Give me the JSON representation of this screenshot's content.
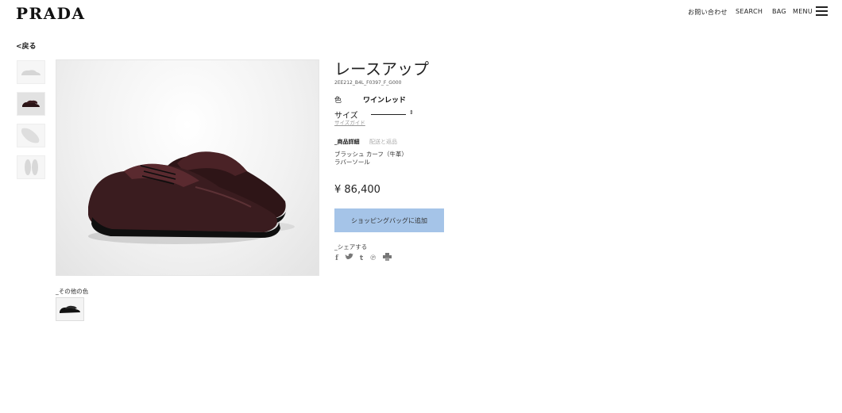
{
  "header": {
    "logo": "PRADA",
    "nav": {
      "contact": "お問い合わせ",
      "search": "SEARCH",
      "bag": "BAG",
      "menu": "MENU"
    }
  },
  "back_link": "<戻る",
  "thumbnails": [
    "side-view",
    "pair-view",
    "top-view",
    "sole-view"
  ],
  "product": {
    "title": "レースアップ",
    "sku": "2EE212_B4L_F0397_F_G000",
    "color_label": "色",
    "color_value": "ワインレッド",
    "size_label": "サイズ",
    "size_guide": "サイズガイド",
    "tabs": [
      "_商品詳細",
      "配送と返品"
    ],
    "materials": [
      "ブラッシュ カーフ（牛革）",
      "ラバーソール"
    ],
    "price": "¥ 86,400",
    "add_to_bag": "ショッピングバッグに追加",
    "share_label": "_シェアする",
    "share_icons": [
      "facebook-icon",
      "twitter-icon",
      "tumblr-icon",
      "pinterest-icon",
      "print-icon"
    ]
  },
  "other_colors": {
    "label": "_その他の色"
  },
  "colors": {
    "shoe": "#3a1c1f",
    "button": "#a5c4e8"
  }
}
